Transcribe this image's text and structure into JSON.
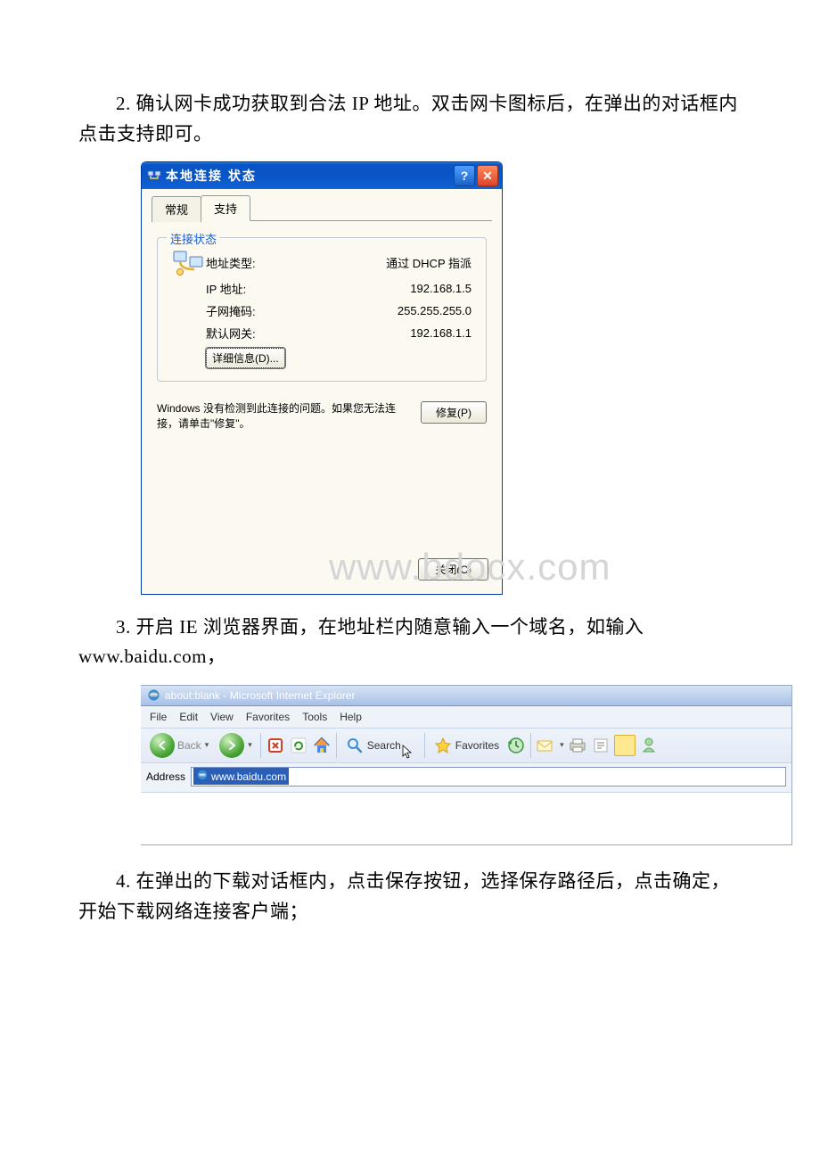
{
  "paragraphs": {
    "p2": "2. 确认网卡成功获取到合法 IP 地址。双击网卡图标后，在弹出的对话框内点击支持即可。",
    "p3": "3. 开启 IE 浏览器界面，在地址栏内随意输入一个域名，如输入www.baidu.com，",
    "p4": "4. 在弹出的下载对话框内，点击保存按钮，选择保存路径后，点击确定，开始下载网络连接客户端；"
  },
  "dialog1": {
    "title": "本地连接 状态",
    "tabs": {
      "general": "常规",
      "support": "支持"
    },
    "group_title": "连接状态",
    "rows": {
      "addr_type_label": "地址类型:",
      "addr_type_value": "通过 DHCP 指派",
      "ip_label": "IP 地址:",
      "ip_value": "192.168.1.5",
      "mask_label": "子网掩码:",
      "mask_value": "255.255.255.0",
      "gw_label": "默认网关:",
      "gw_value": "192.168.1.1"
    },
    "details_btn": "详细信息(D)...",
    "trouble_text": "Windows 没有检测到此连接的问题。如果您无法连接，请单击\"修复\"。",
    "repair_btn": "修复(P)",
    "close_btn": "关闭(C)",
    "watermark": "www.bdocx.com"
  },
  "ie": {
    "title": "about:blank - Microsoft Internet Explorer",
    "menu": [
      "File",
      "Edit",
      "View",
      "Favorites",
      "Tools",
      "Help"
    ],
    "toolbar": {
      "back": "Back",
      "search": "Search",
      "favorites": "Favorites"
    },
    "address_label": "Address",
    "address_value": "www.baidu.com"
  }
}
